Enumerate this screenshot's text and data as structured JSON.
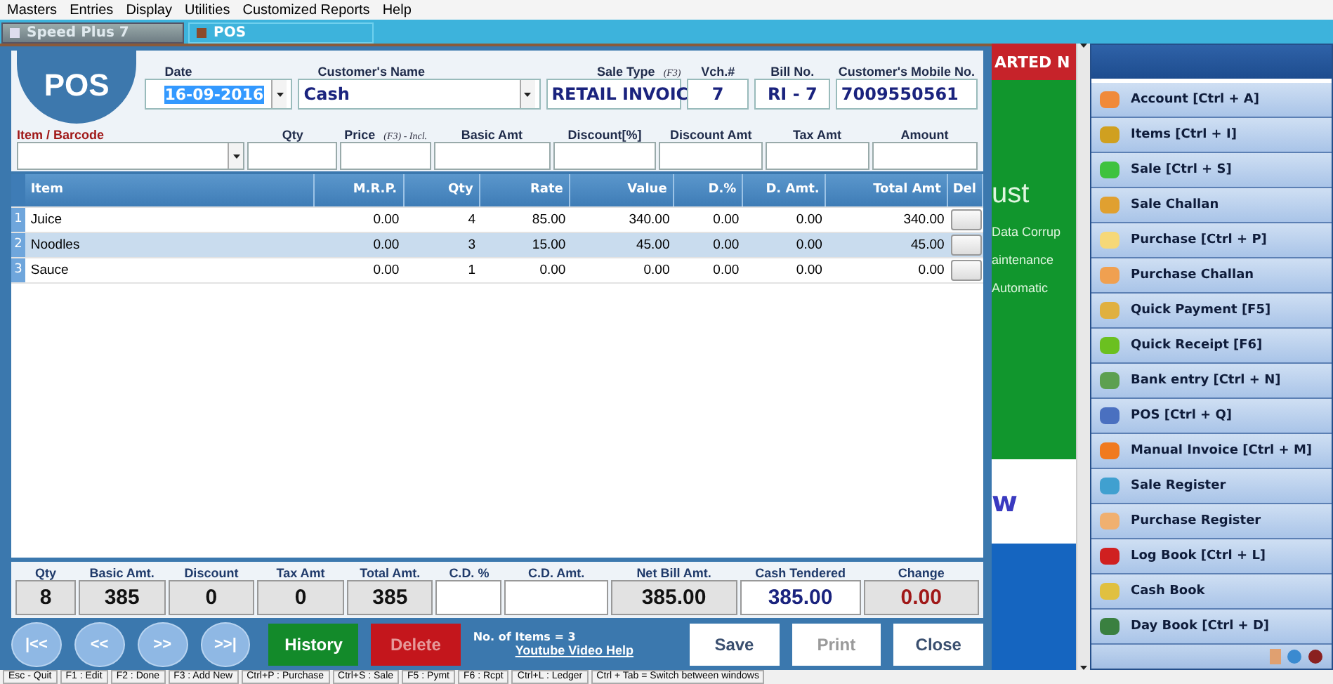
{
  "menu": [
    "Masters",
    "Entries",
    "Display",
    "Utilities",
    "Customized Reports",
    "Help"
  ],
  "tabs": [
    {
      "label": "Speed Plus 7",
      "selected": false
    },
    {
      "label": "POS",
      "selected": true
    }
  ],
  "pos": {
    "logo": "POS",
    "header_fields": [
      {
        "label": "Date",
        "value": "16-09-2016",
        "kind": "date"
      },
      {
        "label": "Customer's Name",
        "value": "Cash",
        "kind": "combo"
      },
      {
        "label": "Sale Type",
        "hint": "(F3)",
        "value": "RETAIL INVOIC",
        "kind": "combo"
      },
      {
        "label": "Vch.#",
        "value": "7",
        "kind": "text"
      },
      {
        "label": "Bill No.",
        "value": "RI - 7",
        "kind": "text"
      },
      {
        "label": "Customer's Mobile No.",
        "value": "7009550561",
        "kind": "text"
      }
    ],
    "entry_fields": [
      {
        "label": "Item / Barcode",
        "kind": "combo"
      },
      {
        "label": "Qty",
        "kind": "text"
      },
      {
        "label": "Price",
        "hint": "(F3) - Incl.",
        "kind": "text"
      },
      {
        "label": "Basic Amt",
        "kind": "text"
      },
      {
        "label": "Discount[%]",
        "kind": "text"
      },
      {
        "label": "Discount Amt",
        "kind": "text"
      },
      {
        "label": "Tax Amt",
        "kind": "text"
      },
      {
        "label": "Amount",
        "kind": "text"
      }
    ],
    "table": {
      "columns": [
        "Item",
        "M.R.P.",
        "Qty",
        "Rate",
        "Value",
        "D.%",
        "D. Amt.",
        "Total Amt",
        "Del"
      ],
      "rows": [
        {
          "index": "1",
          "selected": false,
          "cells": [
            "Juice",
            "0.00",
            "4",
            "85.00",
            "340.00",
            "0.00",
            "0.00",
            "340.00"
          ]
        },
        {
          "index": "2",
          "selected": true,
          "cells": [
            "Noodles",
            "0.00",
            "3",
            "15.00",
            "45.00",
            "0.00",
            "0.00",
            "45.00"
          ]
        },
        {
          "index": "3",
          "selected": false,
          "cells": [
            "Sauce",
            "0.00",
            "1",
            "0.00",
            "0.00",
            "0.00",
            "0.00",
            "0.00"
          ]
        }
      ]
    },
    "totals": [
      {
        "label": "Qty",
        "value": "8",
        "kind": "readonly"
      },
      {
        "label": "Basic Amt.",
        "value": "385",
        "kind": "readonly"
      },
      {
        "label": "Discount",
        "value": "0",
        "kind": "readonly"
      },
      {
        "label": "Tax Amt",
        "value": "0",
        "kind": "readonly"
      },
      {
        "label": "Total Amt.",
        "value": "385",
        "kind": "readonly"
      },
      {
        "label": "C.D. %",
        "kind": "input"
      },
      {
        "label": "C.D. Amt.",
        "kind": "input"
      },
      {
        "label": "Net Bill Amt.",
        "value": "385.00",
        "kind": "readonly"
      },
      {
        "label": "Cash Tendered",
        "value": "385.00",
        "kind": "tendered"
      },
      {
        "label": "Change",
        "value": "0.00",
        "kind": "change"
      }
    ],
    "nav_buttons": [
      "|<<",
      "<<",
      ">>",
      ">>|"
    ],
    "actions_left": [
      {
        "label": "History",
        "kind": "green",
        "disabled": false
      },
      {
        "label": "Delete",
        "kind": "red",
        "disabled": true
      }
    ],
    "items_count": "No. of Items = 3",
    "help_link": "Youtube Video Help",
    "actions_right": [
      {
        "label": "Save",
        "disabled": false
      },
      {
        "label": "Print",
        "disabled": true
      },
      {
        "label": "Close",
        "disabled": false
      }
    ]
  },
  "ad": {
    "banner": "ARTED N",
    "lines": [
      "ust",
      "Data Corrup",
      "aintenance",
      "Automatic"
    ],
    "footer": "w"
  },
  "sidebar": {
    "items": [
      "Account [Ctrl + A]",
      "Items [Ctrl + I]",
      "Sale [Ctrl + S]",
      "Sale Challan",
      "Purchase [Ctrl + P]",
      "Purchase Challan",
      "Quick Payment [F5]",
      "Quick Receipt [F6]",
      "Bank entry [Ctrl + N]",
      "POS [Ctrl + Q]",
      "Manual Invoice [Ctrl + M]",
      "Sale Register",
      "Purchase Register",
      "Log Book [Ctrl + L]",
      "Cash Book",
      "Day Book [Ctrl + D]"
    ]
  },
  "status_bar": [
    "Esc - Quit",
    "F1 : Edit",
    "F2 : Done",
    "F3 : Add New",
    "Ctrl+P : Purchase",
    "Ctrl+S : Sale",
    "F5 : Pymt",
    "F6 : Rcpt",
    "Ctrl+L : Ledger",
    "Ctrl + Tab = Switch between windows"
  ]
}
